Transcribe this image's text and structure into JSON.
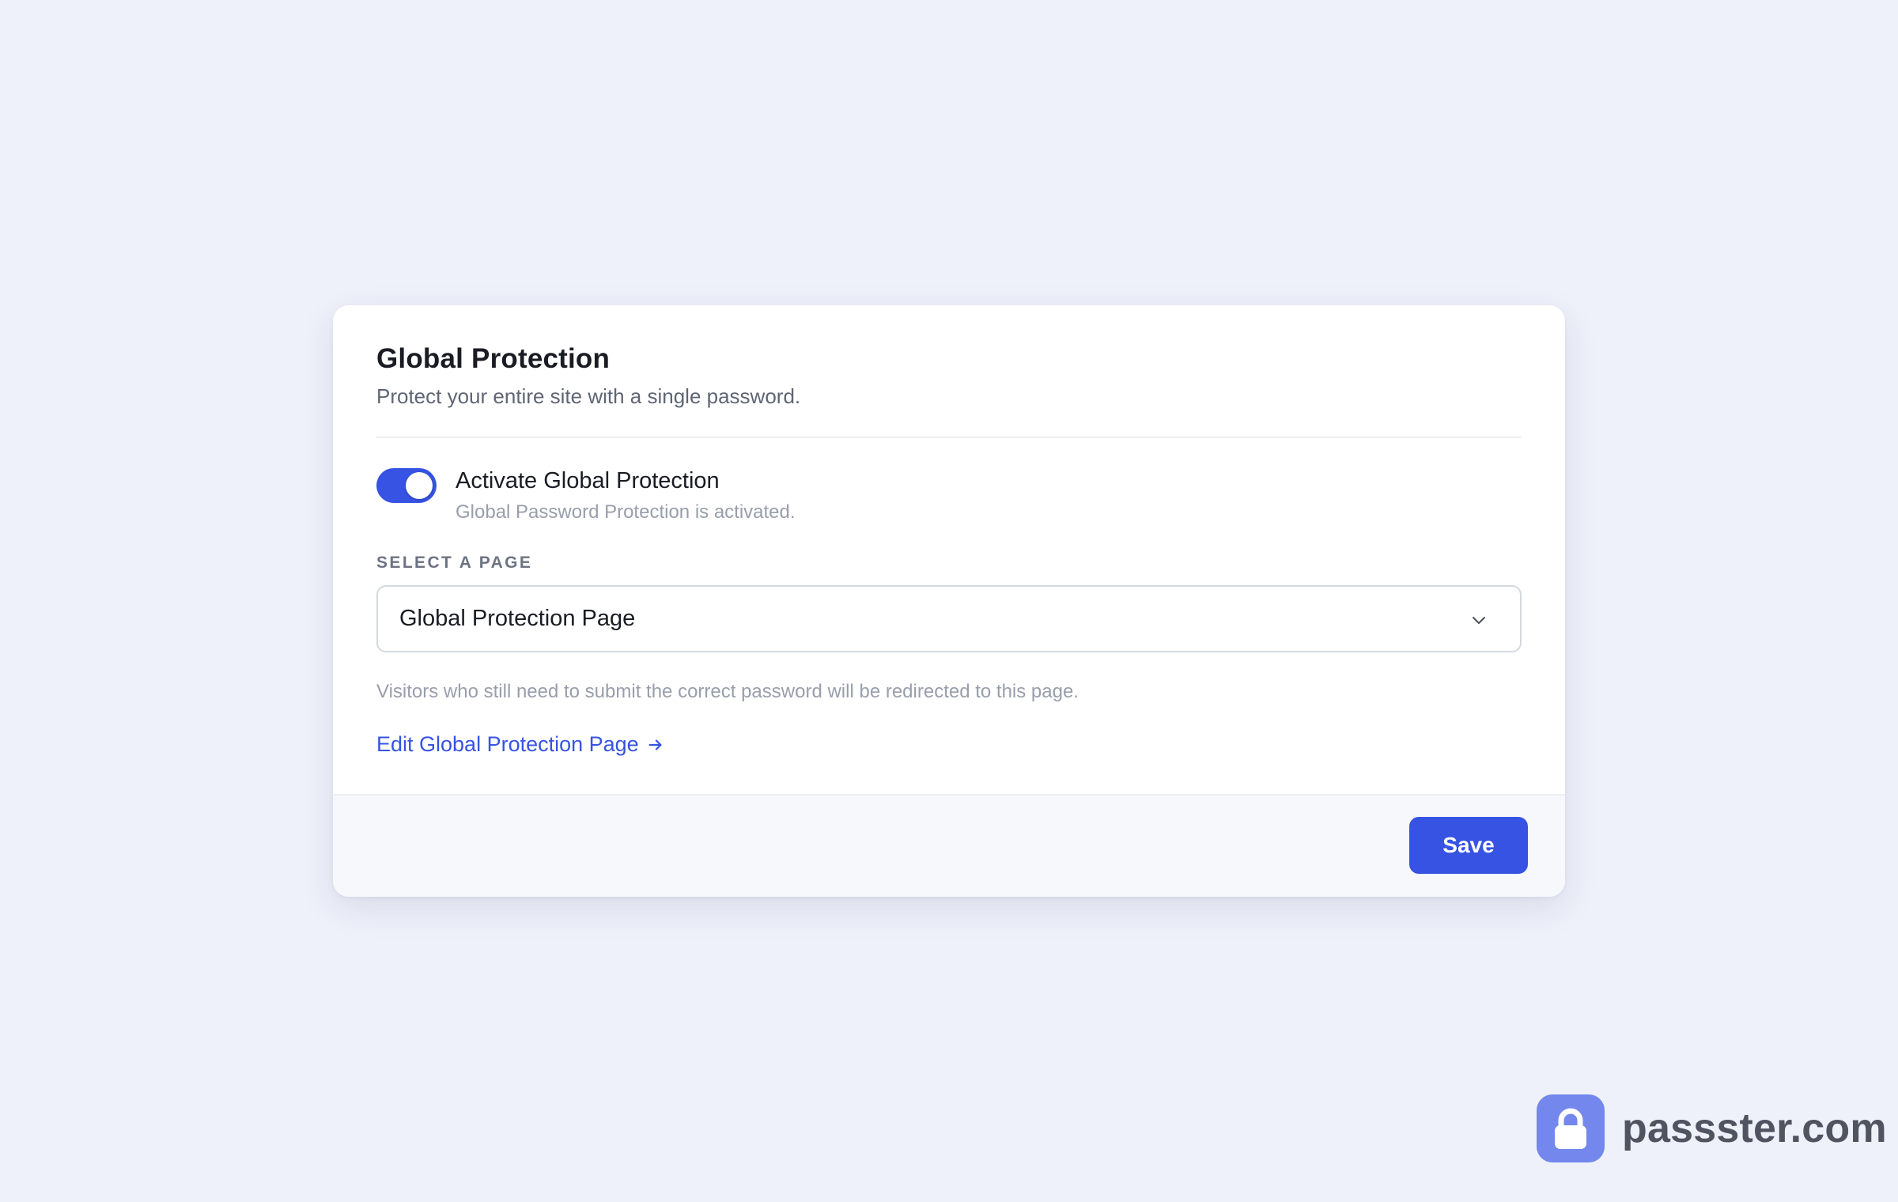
{
  "card": {
    "title": "Global Protection",
    "subtitle": "Protect your entire site with a single password.",
    "toggle": {
      "label": "Activate Global Protection",
      "description": "Global Password Protection is activated.",
      "checked": true
    },
    "select": {
      "label": "SELECT A PAGE",
      "value": "Global Protection Page",
      "icon": "chevron-down-icon"
    },
    "help_text": "Visitors who still need to submit the correct password will be redirected to this page.",
    "edit_link": {
      "label": "Edit Global Protection Page",
      "icon": "arrow-right-icon"
    },
    "footer": {
      "save_label": "Save"
    }
  },
  "brand": {
    "name": "passster.com",
    "icon": "lock-icon"
  },
  "colors": {
    "accent": "#3753e3",
    "background": "#eef0fa",
    "logo": "#7387ec"
  }
}
